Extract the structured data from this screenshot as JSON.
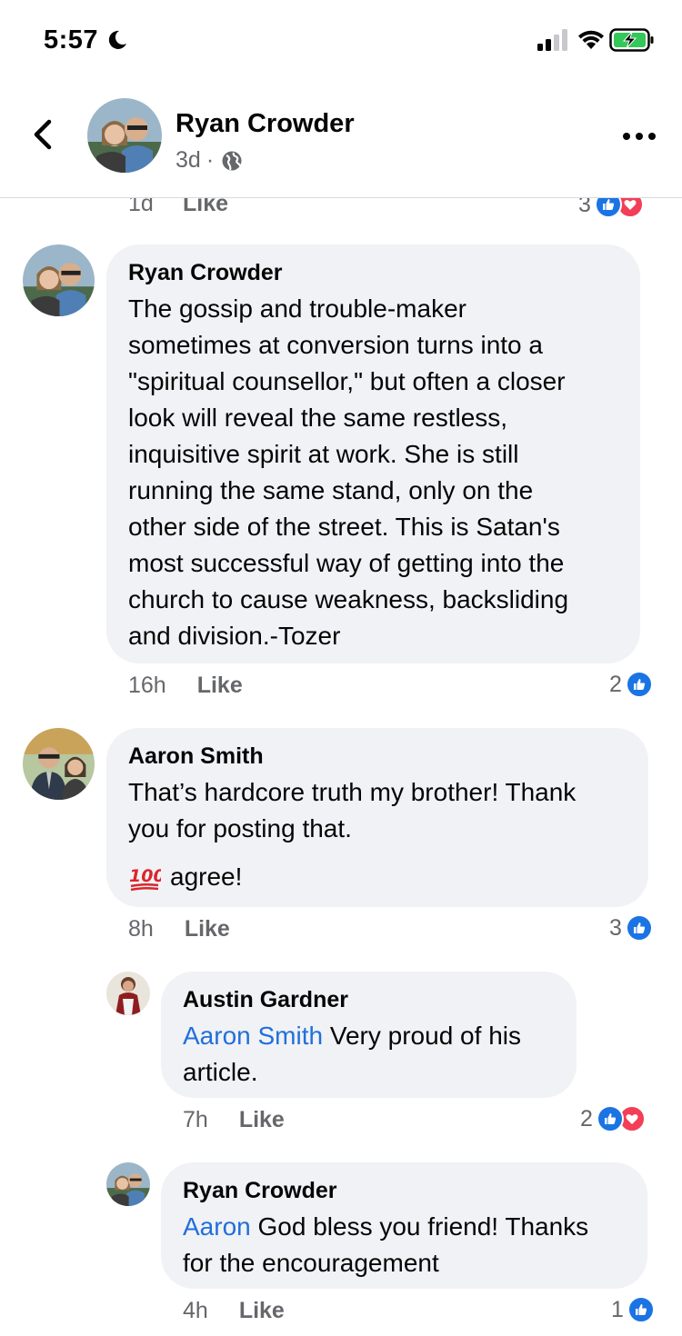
{
  "status_bar": {
    "time": "5:57"
  },
  "post_header": {
    "author": "Ryan Crowder",
    "age": "3d",
    "separator": "·"
  },
  "previous_comment": {
    "time": "1d",
    "like_label": "Like",
    "reaction_count": "3"
  },
  "comments": [
    {
      "author": "Ryan Crowder",
      "lines": [
        "The gossip and trouble-maker",
        "sometimes at conversion turns into a",
        "\"spiritual counsellor,\" but often a closer",
        "look will reveal the same restless,",
        "inquisitive spirit at work.  She is still",
        "running the same stand, only on the",
        "other side of the street.  This is Satan's",
        "most successful way of getting into the",
        "church to cause weakness, backsliding",
        "and division.-Tozer"
      ],
      "time": "16h",
      "like_label": "Like",
      "reaction_count": "2"
    },
    {
      "author": "Aaron Smith",
      "lines": [
        "That’s hardcore truth my brother! Thank",
        "you for posting that."
      ],
      "emoji_line": "agree!",
      "emoji": "100",
      "time": "8h",
      "like_label": "Like",
      "reaction_count": "3"
    },
    {
      "author": "Austin Gardner",
      "mention": "Aaron Smith",
      "line1_rest": " Very proud of his",
      "line2": "article.",
      "time": "7h",
      "like_label": "Like",
      "reaction_count": "2"
    },
    {
      "author": "Ryan Crowder",
      "mention": "Aaron",
      "line1_rest": " God bless you friend! Thanks",
      "line2": "for the encouragement",
      "time": "4h",
      "like_label": "Like",
      "reaction_count": "1"
    }
  ],
  "colors": {
    "bubble": "#f0f2f5",
    "mention": "#216fdb",
    "like_reaction": "#1b74e4",
    "love_reaction": "#f33e58",
    "meta_text": "#65676b"
  }
}
